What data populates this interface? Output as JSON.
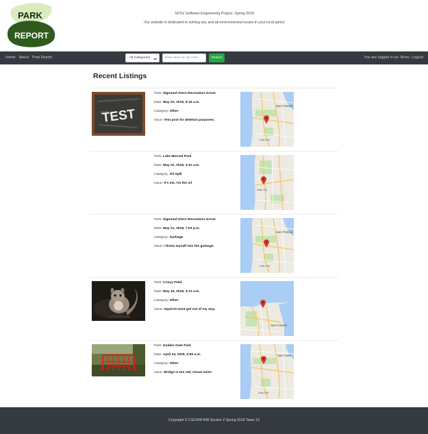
{
  "logo": {
    "line1": "PARK",
    "line2": "REPORT",
    "colors": {
      "leaf_light": "#d8ecc0",
      "leaf_dark": "#2f5a1e",
      "text_dark": "#1b2a10",
      "text_light": "#ffffff"
    }
  },
  "header": {
    "tagline1": "SFSU Software Engineering Project, Spring 2018",
    "tagline2": "Our website is dedicated to solving any and all environmental issues in your local parks!"
  },
  "nav": {
    "links": [
      "Home",
      "About",
      "Post Report"
    ],
    "category_select": "All Categories",
    "search_placeholder": "Park name or zip code",
    "search_button": "Search",
    "logged_in_text": "You are logged in as: Wvso",
    "logout": "Logout"
  },
  "main": {
    "title": "Recent Listings",
    "labels": {
      "park": "Park:",
      "date": "Date:",
      "category": "Category:",
      "issue": "Issue:"
    },
    "listings": [
      {
        "park": "Sigmund Stern Recreation Grove",
        "date": "May 22, 2018, 5:15 a.m.",
        "category": "Other",
        "issue": "Test post for deletion purposes.",
        "image": "chalkboard-test-photo",
        "image_text": "TEST",
        "map_pin": "map-pin-icon",
        "map_labels": [
          "San Francis",
          "Daly City"
        ]
      },
      {
        "park": "Lake Merced Park",
        "date": "May 22, 2018, 3:41 a.m.",
        "category": "Oil Spill",
        "issue": "It's me, I'm the oil",
        "image": "",
        "map_pin": "map-pin-icon",
        "map_labels": [
          "Daly City"
        ]
      },
      {
        "park": "Sigmund Stern Recreation Grove",
        "date": "May 21, 2018, 7:03 p.m.",
        "category": "Garbage",
        "issue": "I threw myself into the garbage.",
        "image": "",
        "map_pin": "map-pin-icon",
        "map_labels": [
          "San Francis",
          "Daly City"
        ]
      },
      {
        "park": "Crissy Field",
        "date": "May 15, 2018, 4:13 a.m.",
        "category": "Other",
        "issue": "Squirrel wont get out of my way.",
        "image": "squirrel-photo",
        "map_pin": "map-pin-icon",
        "map_labels": [
          "San Francis"
        ]
      },
      {
        "park": "Golden Gate Park",
        "date": "April 24, 2018, 9:59 a.m.",
        "category": "Other",
        "issue": "Bridge is too red, visual noise",
        "image": "red-bridge-photo",
        "map_pin": "map-pin-icon",
        "map_labels": [
          "San Franc",
          "Daly City"
        ]
      }
    ]
  },
  "footer": {
    "copyright": "Copyright © CSC648-848 Section 2 Spring 2018 Team 13"
  },
  "colors": {
    "navbar": "#343a40",
    "search_button": "#28a745",
    "map_water": "#a9cdf4",
    "map_land": "#eceae2",
    "map_park": "#c6e3b4",
    "map_road": "#f6c86b",
    "pin": "#d33b2c"
  }
}
